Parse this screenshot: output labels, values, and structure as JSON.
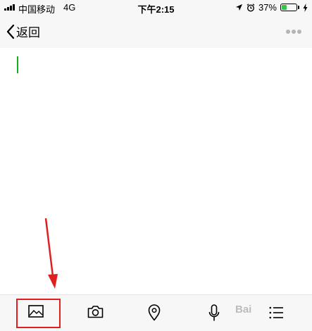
{
  "status_bar": {
    "carrier": "中国移动",
    "network": "4G",
    "time": "下午2:15",
    "battery_percent": "37%",
    "battery_level": 0.37,
    "battery_color": "#39c24a",
    "icons": [
      "signal-bars-icon",
      "location-arrow-icon",
      "alarm-clock-icon",
      "battery-icon",
      "charging-bolt-icon"
    ]
  },
  "nav": {
    "back_label": "返回",
    "back_icon": "chevron-left-icon",
    "more_icon": "more-dots-icon"
  },
  "editor": {
    "cursor_color": "#1aad19",
    "content": ""
  },
  "toolbar": {
    "items": [
      {
        "name": "image",
        "icon": "image-icon",
        "highlighted": true
      },
      {
        "name": "camera",
        "icon": "camera-icon"
      },
      {
        "name": "location",
        "icon": "location-pin-icon"
      },
      {
        "name": "voice",
        "icon": "microphone-icon"
      },
      {
        "name": "list",
        "icon": "list-icon"
      }
    ]
  },
  "annotation": {
    "color": "#e02020",
    "arrow_target": "image-icon"
  },
  "watermark": "Bai"
}
